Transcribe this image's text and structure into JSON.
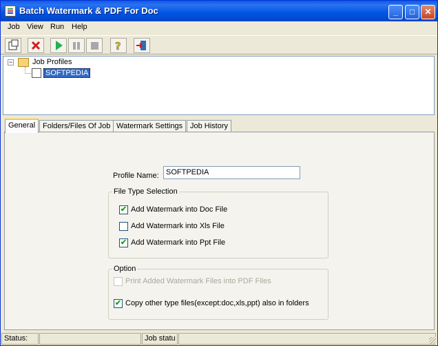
{
  "window": {
    "title": "Batch Watermark & PDF For Doc"
  },
  "titlebar": {
    "minimize": "_",
    "maximize": "□",
    "close": "✕"
  },
  "menubar": {
    "items": [
      "Job",
      "View",
      "Run",
      "Help"
    ]
  },
  "toolbar": {
    "icons": [
      "new-profile-icon",
      "delete-icon",
      "run-icon",
      "pause-icon",
      "stop-icon",
      "help-icon",
      "exit-icon"
    ]
  },
  "tree": {
    "root_label": "Job Profiles",
    "child_label": "SOFTPEDIA",
    "expander": "−"
  },
  "tabs": [
    "General",
    "Folders/Files Of Job",
    "Watermark Settings",
    "Job History"
  ],
  "general": {
    "profile_name_label": "Profile Name:",
    "profile_name_value": "SOFTPEDIA",
    "file_type_group": "File Type Selection",
    "file_types": [
      {
        "label": "Add Watermark into Doc File",
        "checked": true
      },
      {
        "label": "Add Watermark into Xls File",
        "checked": false
      },
      {
        "label": "Add Watermark into Ppt File",
        "checked": true
      }
    ],
    "option_group": "Option",
    "options": [
      {
        "label": "Print Added Watermark Files into PDF Files",
        "checked": false,
        "disabled": true
      },
      {
        "label": "Copy other type files(except:doc,xls,ppt) also in folders",
        "checked": true,
        "disabled": false
      }
    ],
    "check_mark": "✔"
  },
  "statusbar": {
    "status_label": "Status:",
    "job_status": "Job statu"
  },
  "colors": {
    "titlebar": "#0054e3",
    "selection": "#316ac5",
    "face": "#ece9d8",
    "check": "#21a121"
  }
}
